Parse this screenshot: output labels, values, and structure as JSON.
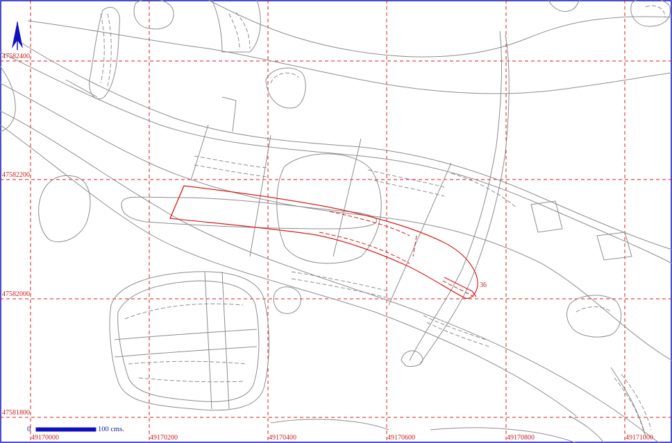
{
  "map": {
    "grid_x_labels": [
      "49170000",
      "49170200",
      "49170400",
      "49170600",
      "49170800",
      "49171000"
    ],
    "grid_y_labels": [
      "47582400",
      "47582200",
      "47582000",
      "47581800"
    ],
    "feature_label": "36",
    "scale": {
      "start": "0",
      "end": "100 cms."
    },
    "north_arrow": "north-arrow-icon",
    "colors": {
      "grid": "#d81b1b",
      "contour": "#8c8c8c",
      "feature": "#d81b1b",
      "frame": "#1010c0",
      "scale": "#1a1a9a"
    }
  }
}
